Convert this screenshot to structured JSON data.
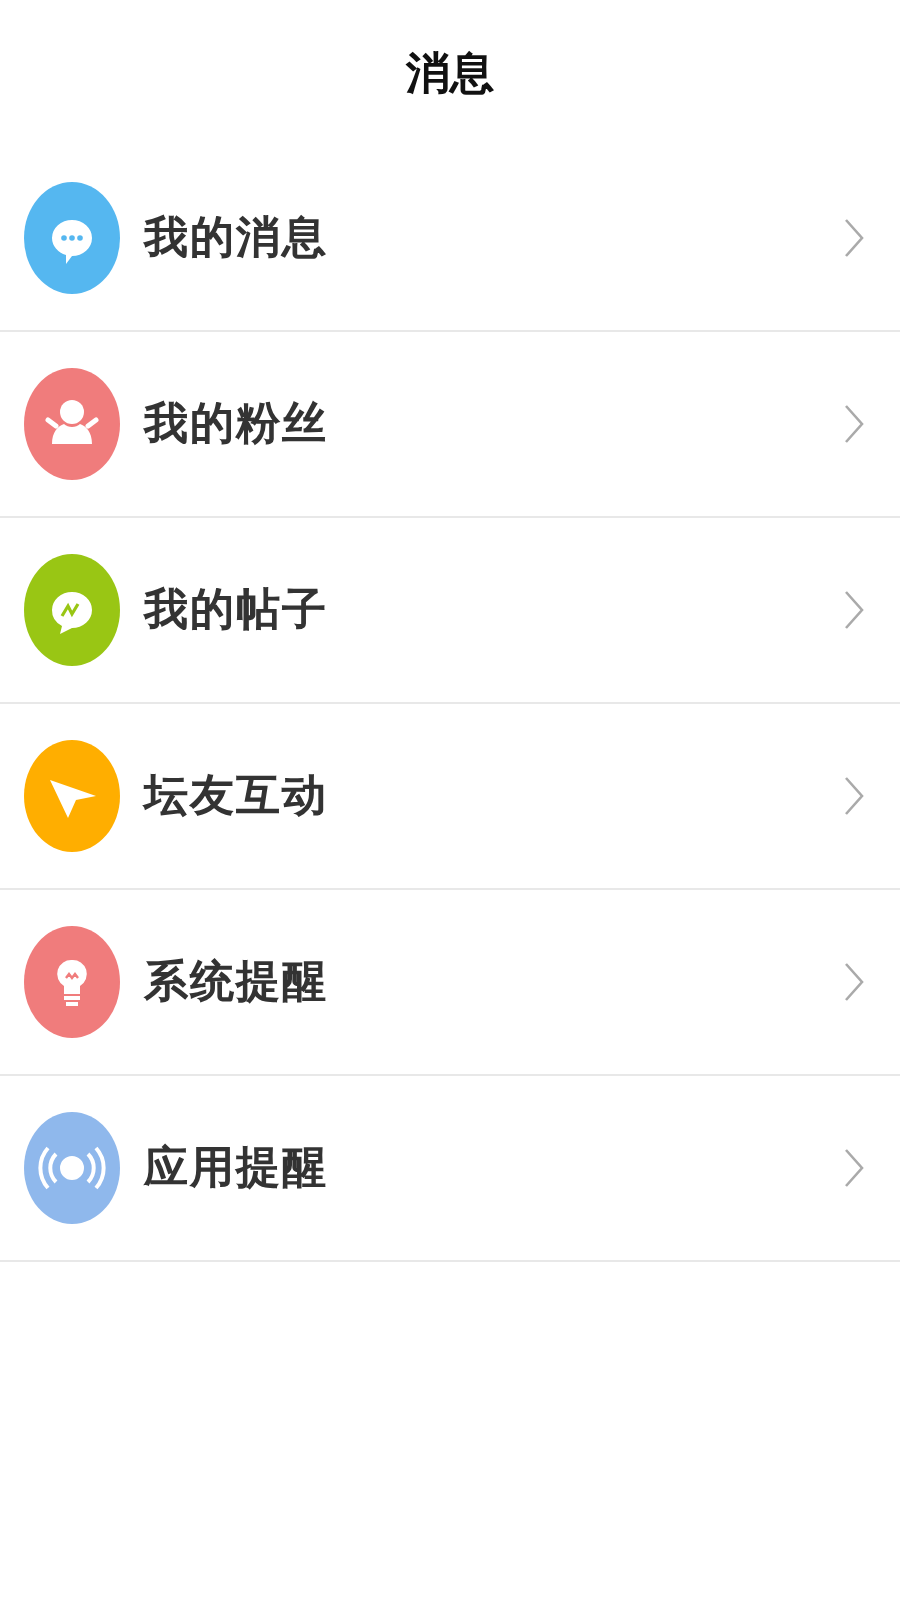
{
  "header": {
    "title": "消息"
  },
  "items": [
    {
      "label": "我的消息",
      "kind": "chat",
      "color": "#55b7f0"
    },
    {
      "label": "我的粉丝",
      "kind": "fans",
      "color": "#f07c7c"
    },
    {
      "label": "我的帖子",
      "kind": "post",
      "color": "#99c614"
    },
    {
      "label": "坛友互动",
      "kind": "plane",
      "color": "#ffae00"
    },
    {
      "label": "系统提醒",
      "kind": "bulb",
      "color": "#f07c7c"
    },
    {
      "label": "应用提醒",
      "kind": "signal",
      "color": "#8fb8ec"
    }
  ]
}
